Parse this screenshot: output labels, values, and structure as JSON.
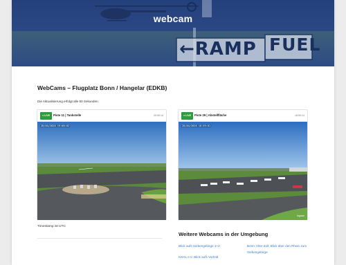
{
  "hero": {
    "title": "webcam",
    "sign_ramp": "←RAMP",
    "sign_fuel": "FUEL"
  },
  "page": {
    "heading": "WebCams – Flugplatz Bonn / Hangelar (EDKB)",
    "update_note": "Die Aktualisierung erfolgt alle 60 Sekunden."
  },
  "cams": [
    {
      "badge": "● LIVE",
      "name": "Piste 11 | Tankstelle",
      "time": "20:59:14",
      "stamp": "28/04/2020  19:00:02",
      "mark": ""
    },
    {
      "badge": "● LIVE",
      "name": "Piste 29 | Abstellfläche",
      "time": "18:59:14",
      "stamp": "28/04/2020  18:59:01",
      "mark": "Ing4an"
    }
  ],
  "footer": {
    "timestamp_note": "Timestamp ist UTC"
  },
  "more": {
    "title": "Weitere Webcams in der Umgebung",
    "links": [
      "Blick aufs Siebengebirge 1+2",
      "Bonn: Alter Zoll: Blick über den Rhein zum Siebengebirge",
      "KKHL e.V. Blick aufs Vorfeld"
    ]
  },
  "colors": {
    "hero_tint": "#2a4a86",
    "live_green": "#2e9c3e",
    "link_blue": "#3a7dc9"
  }
}
